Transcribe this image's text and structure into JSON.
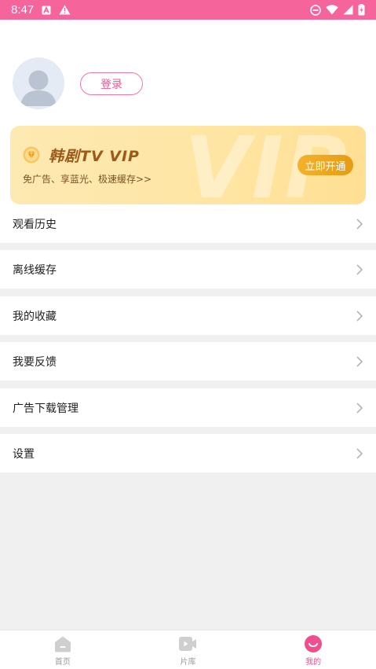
{
  "status_bar": {
    "time": "8:47",
    "icons_left": [
      "a-box-icon",
      "warning-icon"
    ],
    "icons_right": [
      "dnd-icon",
      "wifi-icon",
      "cell-signal-icon",
      "battery-charging-icon"
    ]
  },
  "profile": {
    "avatar_icon": "default-avatar-icon",
    "login_label": "登录"
  },
  "vip": {
    "title": "韩剧TV VIP",
    "watermark": "VIP",
    "description": "免广告、享蓝光、极速缓存>>",
    "button_label": "立即开通",
    "badge_icon": "diamond-icon"
  },
  "menu": {
    "items": [
      {
        "label": "观看历史"
      },
      {
        "label": "离线缓存"
      },
      {
        "label": "我的收藏"
      },
      {
        "label": "我要反馈"
      },
      {
        "label": "广告下载管理"
      },
      {
        "label": "设置"
      }
    ]
  },
  "tabbar": {
    "tabs": [
      {
        "label": "首页",
        "icon": "home-icon",
        "active": false
      },
      {
        "label": "片库",
        "icon": "video-library-icon",
        "active": false
      },
      {
        "label": "我的",
        "icon": "profile-smile-icon",
        "active": true
      }
    ]
  },
  "colors": {
    "accent": "#f5649a",
    "vip_gold": "#e59c12"
  }
}
